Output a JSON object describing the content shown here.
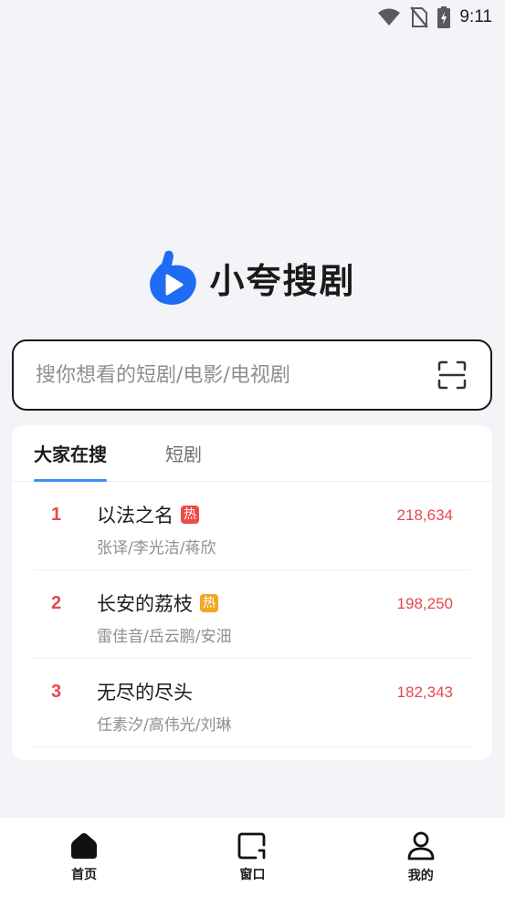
{
  "status_bar": {
    "time": "9:11",
    "icons": [
      "wifi-icon",
      "no-sim-icon",
      "battery-charging-icon"
    ]
  },
  "brand": {
    "name": "小夸搜剧",
    "logo_icon": "play-thumb-logo",
    "logo_color": "#1f6bf5"
  },
  "search": {
    "placeholder": "搜你想看的短剧/电影/电视剧",
    "value": "",
    "scan_icon": "scan-icon"
  },
  "tabs": [
    {
      "label": "大家在搜",
      "active": true
    },
    {
      "label": "短剧",
      "active": false
    }
  ],
  "ranking": [
    {
      "rank": "1",
      "title": "以法之名",
      "badge": "热",
      "badge_color": "#f04a48",
      "cast": "张译/李光洁/蒋欣",
      "count": "218,634"
    },
    {
      "rank": "2",
      "title": "长安的荔枝",
      "badge": "热",
      "badge_color": "#f5a623",
      "cast": "雷佳音/岳云鹏/安沺",
      "count": "198,250"
    },
    {
      "rank": "3",
      "title": "无尽的尽头",
      "badge": "",
      "badge_color": "",
      "cast": "任素汐/高伟光/刘琳",
      "count": "182,343"
    }
  ],
  "bottom_nav": [
    {
      "label": "首页",
      "icon": "home-icon"
    },
    {
      "label": "窗口",
      "icon": "window-icon"
    },
    {
      "label": "我的",
      "icon": "profile-icon"
    }
  ],
  "colors": {
    "accent": "#3a8ef6",
    "rank_red": "#e5484d",
    "background": "#f3f4f7"
  }
}
